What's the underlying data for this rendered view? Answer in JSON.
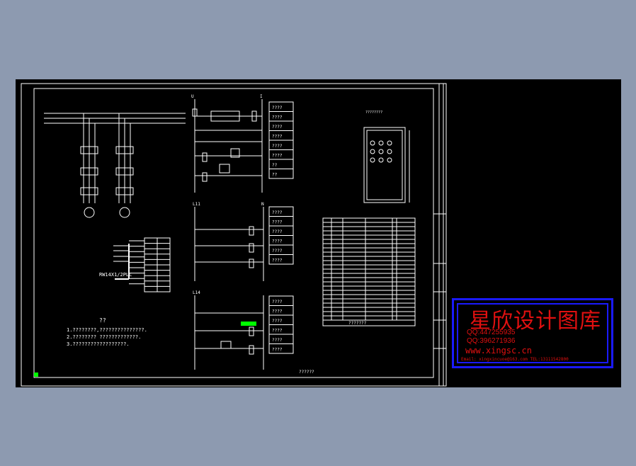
{
  "drawing": {
    "plc_label": "RW14X1/2PLC",
    "notes_title": "??",
    "notes": [
      "1.????????,???????????????.",
      "2.???????? ?????????????.",
      "3.??????????????????."
    ],
    "circuit_labels": {
      "top_left": "U",
      "top_right": "I",
      "mid": "L11",
      "bottom": "L14",
      "mid_right": "N"
    },
    "legend_boxes_top": [
      "????",
      "????",
      "????",
      "????",
      "????",
      "????",
      "??",
      "??"
    ],
    "legend_boxes_mid": [
      "????",
      "????",
      "????",
      "????",
      "????",
      "????"
    ],
    "legend_boxes_bottom": [
      "????",
      "????",
      "????",
      "????",
      "????",
      "????"
    ],
    "panel_title": "????????",
    "table_footer": "???????",
    "drawing_no": "??????"
  },
  "watermark": {
    "title": "星欣设计图库",
    "qq1": "QQ:447255935",
    "qq2": "QQ:396271936",
    "url": "www.xingsc.cn",
    "contact": "Email: xingxincuoe@163.com  TEL:13111542800"
  },
  "colors": {
    "background": "#8d9ab0",
    "canvas": "#000000",
    "lines": "#ffffff",
    "watermark_red": "#e01010",
    "watermark_blue": "#1a1aff",
    "highlight_green": "#00ff00"
  }
}
